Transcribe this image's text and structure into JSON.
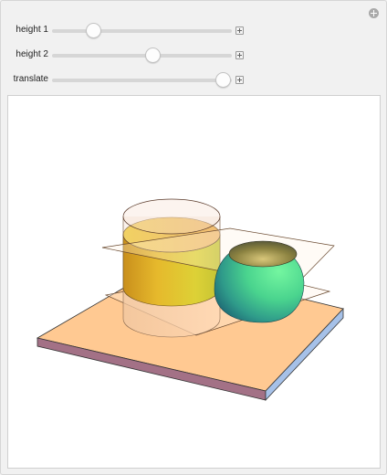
{
  "controls": [
    {
      "label": "height 1",
      "value": 0.23
    },
    {
      "label": "height 2",
      "value": 0.56
    },
    {
      "label": "translate",
      "value": 0.95
    }
  ],
  "icons": {
    "corner": "circle-plus-icon",
    "stepper": "plus-box-icon"
  },
  "scene": {
    "plate_color": "#ffc992",
    "plate_front_color": "#a37186",
    "plate_side_color": "#a6c1e8",
    "cylinder_color": "#e9c531",
    "cap_color": "#61f2a3",
    "plane_color": "#fff2e2"
  }
}
